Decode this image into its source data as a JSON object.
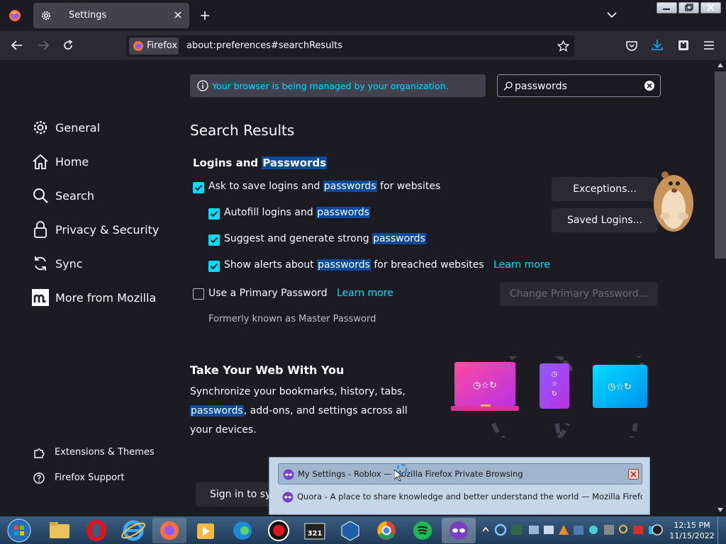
{
  "tab": {
    "title": "Settings"
  },
  "urlbar": {
    "identity": "Firefox",
    "url": "about:preferences#searchResults"
  },
  "notice": {
    "text": "Your browser is being managed by your organization."
  },
  "search": {
    "value": "passwords",
    "placeholder": ""
  },
  "nav": {
    "general": "General",
    "home": "Home",
    "search": "Search",
    "privacy": "Privacy & Security",
    "sync": "Sync",
    "mozilla": "More from Mozilla",
    "extensions": "Extensions & Themes",
    "support": "Firefox Support"
  },
  "main": {
    "heading": "Search Results",
    "logins": {
      "title_prefix": "Logins and",
      "title_hl": "Passwords",
      "ask": {
        "pre": "Ask to save logins and",
        "hl": "passwords",
        "post": "for websites",
        "checked": true
      },
      "autofill": {
        "pre": "Autofill logins and",
        "hl": "passwords",
        "checked": true
      },
      "suggest": {
        "pre": "Suggest and generate strong",
        "hl": "passwords",
        "checked": true
      },
      "alerts": {
        "pre": "Show alerts about",
        "hl": "passwords",
        "post": "for breached websites",
        "link": "Learn more",
        "checked": true
      },
      "primary": {
        "label": "Use a Primary Password",
        "link": "Learn more",
        "checked": false
      },
      "formerly": "Formerly known as Master Password",
      "exceptions_btn": "Exceptions...",
      "saved_btn": "Saved Logins...",
      "change_primary_btn": "Change Primary Password..."
    },
    "sync": {
      "title": "Take Your Web With You",
      "line1": "Synchronize your bookmarks, history, tabs,",
      "hl": "passwords",
      "line2": ", add-ons, and settings across all",
      "line3": "your devices.",
      "signin": "Sign in to sy"
    }
  },
  "popup": {
    "items": [
      "My Settings - Roblox — Mozilla Firefox Private Browsing",
      "Quora - A place to share knowledge and better understand the world — Mozilla Firefox Priv..."
    ]
  },
  "taskbar": {
    "time": "12:15 PM",
    "date": "11/15/2022"
  },
  "colors": {
    "accent": "#00ddff",
    "highlight": "#0a4a9d",
    "background": "#1c1b22",
    "toolbar": "#2b2a33"
  }
}
